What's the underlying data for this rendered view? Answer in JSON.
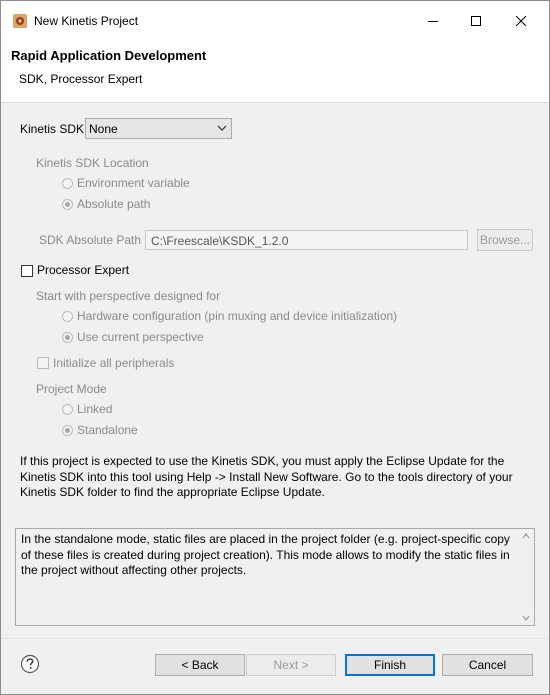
{
  "window": {
    "title": "New Kinetis Project"
  },
  "header": {
    "title": "Rapid Application Development",
    "subtitle": "SDK, Processor Expert"
  },
  "sdk": {
    "label": "Kinetis SDK",
    "selected": "None",
    "location_label": "Kinetis SDK Location",
    "env_var_label": "Environment variable",
    "abs_path_label": "Absolute path",
    "abs_path_field_label": "SDK Absolute Path",
    "abs_path_value": "C:\\Freescale\\KSDK_1.2.0",
    "browse_label": "Browse..."
  },
  "processor_expert": {
    "label": "Processor Expert",
    "perspective_label": "Start with perspective designed for",
    "hw_config_label": "Hardware configuration (pin muxing and device initialization)",
    "current_perspective_label": "Use current perspective",
    "init_peripherals_label": "Initialize all peripherals",
    "project_mode_label": "Project Mode",
    "linked_label": "Linked",
    "standalone_label": "Standalone"
  },
  "info_text": "If this project is expected to use the Kinetis SDK, you must apply the Eclipse Update for the Kinetis SDK into this tool using Help -> Install New Software. Go to the tools directory of your Kinetis SDK folder to find the appropriate Eclipse Update.",
  "description_text": "In the standalone mode, static files are placed in the project folder (e.g.  project-specific copy of these files is created during project creation). This mode allows to modify the static files in the project without affecting other projects.",
  "buttons": {
    "back": "< Back",
    "next": "Next >",
    "finish": "Finish",
    "cancel": "Cancel"
  },
  "icons": {
    "app": "kinetis-app-icon",
    "help": "help-icon",
    "minimize": "minimize-icon",
    "maximize": "maximize-icon",
    "close": "close-icon"
  }
}
